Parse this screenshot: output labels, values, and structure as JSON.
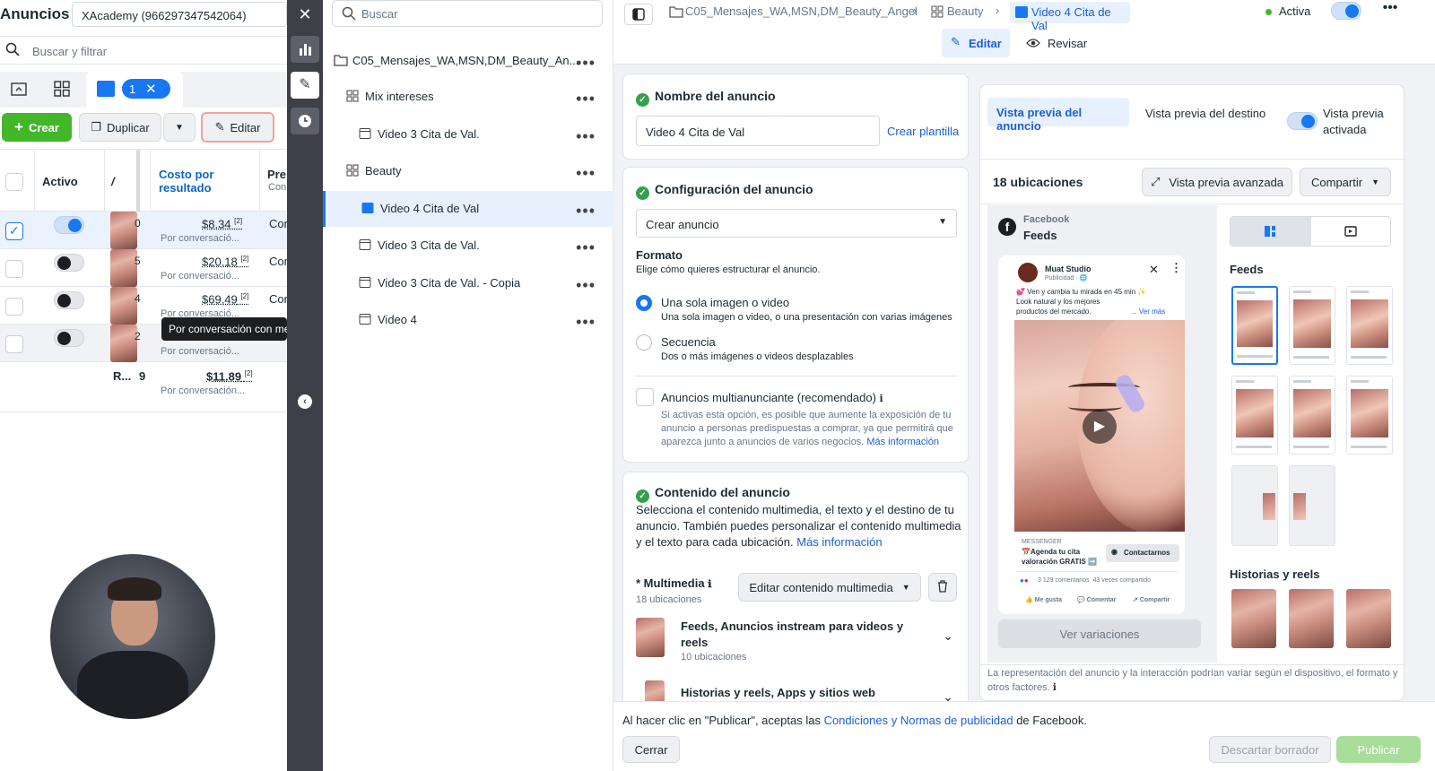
{
  "left": {
    "title": "Anuncios",
    "account": "XAcademy (966297347542064)",
    "search_placeholder": "Buscar y filtrar",
    "tab_count": "1",
    "create": "Crear",
    "duplicate": "Duplicar",
    "edit": "Editar",
    "col_active": "Activo",
    "col_cost": "Costo por resultado",
    "col_pre": "Pre",
    "col_pre_sub": "Con",
    "rows": [
      {
        "cost": "$8.34",
        "note": "[2]",
        "sub": "Por conversació...",
        "pre": "Cor",
        "num": "0"
      },
      {
        "cost": "$20.18",
        "note": "[2]",
        "sub": "Por conversació...",
        "pre": "Cor",
        "num": "5"
      },
      {
        "cost": "$69.49",
        "note": "[2]",
        "sub": "Por conversació...",
        "pre": "Cor",
        "num": "4"
      },
      {
        "cost": "",
        "note": "",
        "sub": "Por conversació...",
        "pre": "",
        "num": "2"
      }
    ],
    "total": {
      "label": "R...",
      "num": "9",
      "cost": "$11.89",
      "note": "[2]",
      "sub": "Por conversación..."
    },
    "tooltip": "Por conversación con mens"
  },
  "tree": {
    "search_placeholder": "Buscar",
    "campaign": "C05_Mensajes_WA,MSN,DM_Beauty_An...",
    "items": [
      {
        "label": "Mix intereses",
        "type": "adset"
      },
      {
        "label": "Video 3 Cita de Val.",
        "type": "ad"
      },
      {
        "label": "Beauty",
        "type": "adset"
      },
      {
        "label": "Video 4 Cita de Val",
        "type": "ad",
        "selected": true
      },
      {
        "label": "Video 3 Cita de Val.",
        "type": "ad"
      },
      {
        "label": "Video 3 Cita de Val. - Copia",
        "type": "ad"
      },
      {
        "label": "Video 4",
        "type": "ad"
      }
    ]
  },
  "breadcrumb": {
    "campaign": "C05_Mensajes_WA,MSN,DM_Beauty_Angel",
    "adset": "Beauty",
    "ad": "Video 4 Cita de Val",
    "status": "Activa"
  },
  "modes": {
    "edit": "Editar",
    "review": "Revisar"
  },
  "name_section": {
    "title": "Nombre del anuncio",
    "value": "Video 4 Cita de Val",
    "template_link": "Crear plantilla"
  },
  "config_section": {
    "title": "Configuración del anuncio",
    "select": "Crear anuncio",
    "format_title": "Formato",
    "format_desc": "Elige cómo quieres estructurar el anuncio.",
    "opt1": "Una sola imagen o video",
    "opt1_desc": "Una sola imagen o video, o una presentación con varias imágenes",
    "opt2": "Secuencia",
    "opt2_desc": "Dos o más imágenes o videos desplazables",
    "multi": "Anuncios multianunciante (recomendado)",
    "multi_desc1": "Si activas esta opción, es posible que aumente la exposición de tu",
    "multi_desc2": "anuncio a personas predispuestas a comprar, ya que permitirá que",
    "multi_desc3": "aparezca junto a anuncios de varios negocios.",
    "more": "Más información"
  },
  "content_section": {
    "title": "Contenido del anuncio",
    "desc1": "Selecciona el contenido multimedia, el texto y el destino de tu",
    "desc2": "anuncio. También puedes personalizar el contenido multimedia",
    "desc3": "y el texto para cada ubicación.",
    "more": "Más información",
    "media_label": "* Multimedia",
    "media_count": "18 ubicaciones",
    "edit_media": "Editar contenido multimedia",
    "placement1": "Feeds, Anuncios instream para videos y",
    "placement1b": "reels",
    "placement1_count": "10 ubicaciones",
    "placement2": "Historias y reels, Apps y sitios web"
  },
  "preview": {
    "tab1": "Vista previa del anuncio",
    "tab2": "Vista previa del destino",
    "toggle_label1": "Vista previa",
    "toggle_label2": "activada",
    "placements": "18 ubicaciones",
    "advanced": "Vista previa avanzada",
    "share": "Compartir",
    "platform": "Facebook",
    "placement": "Feeds",
    "page_name": "Muat Studio",
    "sponsored": "Publicidad · ",
    "post_text1": "💕 Ven y cambia tu mirada en 45 min ✨",
    "post_text2": "Look natural y los mejores",
    "post_text3": "productos del mercado.",
    "see_more": "... Ver más",
    "messenger": "MESSENGER",
    "cta_text1": "📅Agenda tu cita",
    "cta_text2": "valoración GRATIS ➡️",
    "cta_btn": "Contactarnos",
    "comments": "3 129 comentarios  43 veces compartido",
    "like": "Me gusta",
    "comment": "Comentar",
    "share_small": "Compartir",
    "variations": "Ver variaciones",
    "feeds_title": "Feeds",
    "stories_title": "Historias y reels",
    "disclaimer1": "La representación del anuncio y la interacción podrían variar según el dispositivo, el formato y",
    "disclaimer2": "otros factores."
  },
  "footer": {
    "terms_pre": "Al hacer clic en \"Publicar\", aceptas las ",
    "terms_link": "Condiciones y Normas de publicidad",
    "terms_post": " de Facebook.",
    "close": "Cerrar",
    "discard": "Descartar borrador",
    "publish": "Publicar"
  },
  "colors": {
    "accent": "#1877f2",
    "green": "#42b72a",
    "sidebar": "#3d4046"
  }
}
